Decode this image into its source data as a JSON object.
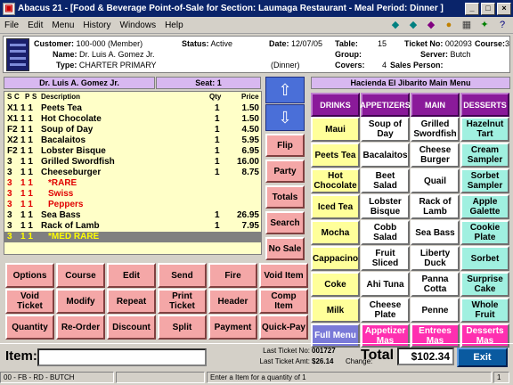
{
  "window": {
    "title": "Abacus 21 - [Food & Beverage Point-of-Sale for Section: Laumaga Restaurant - Meal Period: Dinner ]",
    "min": "_",
    "max": "□",
    "close": "×"
  },
  "menu": {
    "items": [
      "File",
      "Edit",
      "Menu",
      "History",
      "Windows",
      "Help"
    ]
  },
  "toolbar": {
    "icons": [
      "back-arrow-icon",
      "forward-arrow-icon",
      "fish-icon",
      "palette-icon",
      "calculator-icon",
      "exit-runner-icon",
      "help-icon"
    ]
  },
  "info": {
    "customer_label": "Customer:",
    "customer": "100-000 (Member)",
    "name_label": "Name:",
    "name": "Dr. Luis A. Gomez Jr.",
    "type_label": "Type:",
    "type": "CHARTER PRIMARY",
    "status_label": "Status:",
    "status": "Active",
    "date_label": "Date:",
    "date": "12/07/05",
    "period": "(Dinner)",
    "table_label": "Table:",
    "table": "15",
    "group_label": "Group:",
    "group": "",
    "covers_label": "Covers:",
    "covers": "4",
    "ticket_label": "Ticket No:",
    "ticket": "002093",
    "course_label": "Course:",
    "course": "3",
    "server_label": "Server:",
    "server": "Butch",
    "sales_label": "Sales Person:",
    "sales": ""
  },
  "guest": {
    "name": "Dr. Luis A. Gomez Jr.",
    "seat": "Seat: 1"
  },
  "order": {
    "headers": {
      "s": "S",
      "c": "C",
      "p": "P",
      "s2": "S",
      "desc": "Description",
      "qty": "Qty",
      "price": "Price"
    },
    "lines": [
      {
        "sc": "X1",
        "ps": "1 1",
        "desc": "Peets Tea",
        "qty": "1",
        "price": "1.50",
        "kind": "item"
      },
      {
        "sc": "X1",
        "ps": "1 1",
        "desc": "Hot Chocolate",
        "qty": "1",
        "price": "1.50",
        "kind": "item"
      },
      {
        "sc": "F2",
        "ps": "1 1",
        "desc": "Soup of Day",
        "qty": "1",
        "price": "4.50",
        "kind": "item"
      },
      {
        "sc": "X2",
        "ps": "1 1",
        "desc": "Bacalaitos",
        "qty": "1",
        "price": "5.95",
        "kind": "item"
      },
      {
        "sc": "F2",
        "ps": "1 1",
        "desc": "Lobster Bisque",
        "qty": "1",
        "price": "6.95",
        "kind": "item"
      },
      {
        "sc": "3",
        "ps": "1 1",
        "desc": "Grilled Swordfish",
        "qty": "1",
        "price": "16.00",
        "kind": "item"
      },
      {
        "sc": "3",
        "ps": "1 1",
        "desc": "Cheeseburger",
        "qty": "1",
        "price": "8.75",
        "kind": "item"
      },
      {
        "sc": "3",
        "ps": "1 1",
        "desc": "*RARE",
        "qty": "",
        "price": "",
        "kind": "mod"
      },
      {
        "sc": "3",
        "ps": "1 1",
        "desc": "Swiss",
        "qty": "",
        "price": "",
        "kind": "mod"
      },
      {
        "sc": "3",
        "ps": "1 1",
        "desc": "Peppers",
        "qty": "",
        "price": "",
        "kind": "mod"
      },
      {
        "sc": "3",
        "ps": "1 1",
        "desc": "Sea Bass",
        "qty": "1",
        "price": "26.95",
        "kind": "item"
      },
      {
        "sc": "3",
        "ps": "1 1",
        "desc": "Rack of Lamb",
        "qty": "1",
        "price": "7.95",
        "kind": "item"
      },
      {
        "sc": "3",
        "ps": "1 1",
        "desc": "*MED RARE",
        "qty": "",
        "price": "",
        "kind": "sel"
      }
    ]
  },
  "side_buttons": [
    "Flip",
    "Party",
    "Totals",
    "Search",
    "No Sale"
  ],
  "func_buttons": [
    [
      "Options",
      "Course",
      "Edit",
      "Send",
      "Fire",
      "Void Item"
    ],
    [
      "Void Ticket",
      "Modify",
      "Repeat",
      "Print Ticket",
      "Header",
      "Comp Item"
    ],
    [
      "Quantity",
      "Re-Order",
      "Discount",
      "Split",
      "Payment",
      "Quick-Pay"
    ]
  ],
  "menu_panel": {
    "title": "Hacienda El Jibarito Main Menu",
    "categories": [
      "DRINKS",
      "APPETIZERS",
      "MAIN",
      "DESSERTS"
    ],
    "drinks": [
      "Maui",
      "Peets Tea",
      "Hot Chocolate",
      "Iced Tea",
      "Mocha",
      "Cappacino",
      "Coke",
      "Milk",
      "Full Menu"
    ],
    "appetizers": [
      "Soup of Day",
      "Bacalaitos",
      "Beet Salad",
      "Lobster Bisque",
      "Cobb Salad",
      "Fruit Sliced",
      "Ahi Tuna",
      "Cheese Plate",
      "Appetizer Mas"
    ],
    "main": [
      "Grilled Swordfish",
      "Cheese Burger",
      "Quail",
      "Rack of Lamb",
      "Sea Bass",
      "Liberty Duck",
      "Panna Cotta",
      "Penne",
      "Entrees Mas"
    ],
    "desserts": [
      "Hazelnut Tart",
      "Cream Sampler",
      "Sorbet Sampler",
      "Apple Galette",
      "Cookie Plate",
      "Sorbet",
      "Surprise Cake",
      "Whole Fruit",
      "Desserts Mas"
    ]
  },
  "footer": {
    "item_label": "Item:",
    "item_value": "",
    "last_ticket_label": "Last Ticket No:",
    "last_ticket": "001727",
    "last_amt_label": "Last Ticket Amt:",
    "last_amt": "$26.14",
    "change_label": "Change:",
    "change": "",
    "total_label": "Total",
    "total": "$102.34",
    "exit": "Exit"
  },
  "status": {
    "left": "00 - FB - RD - BUTCH",
    "msg": "Enter a Item for a quantity of 1",
    "right": "1"
  }
}
